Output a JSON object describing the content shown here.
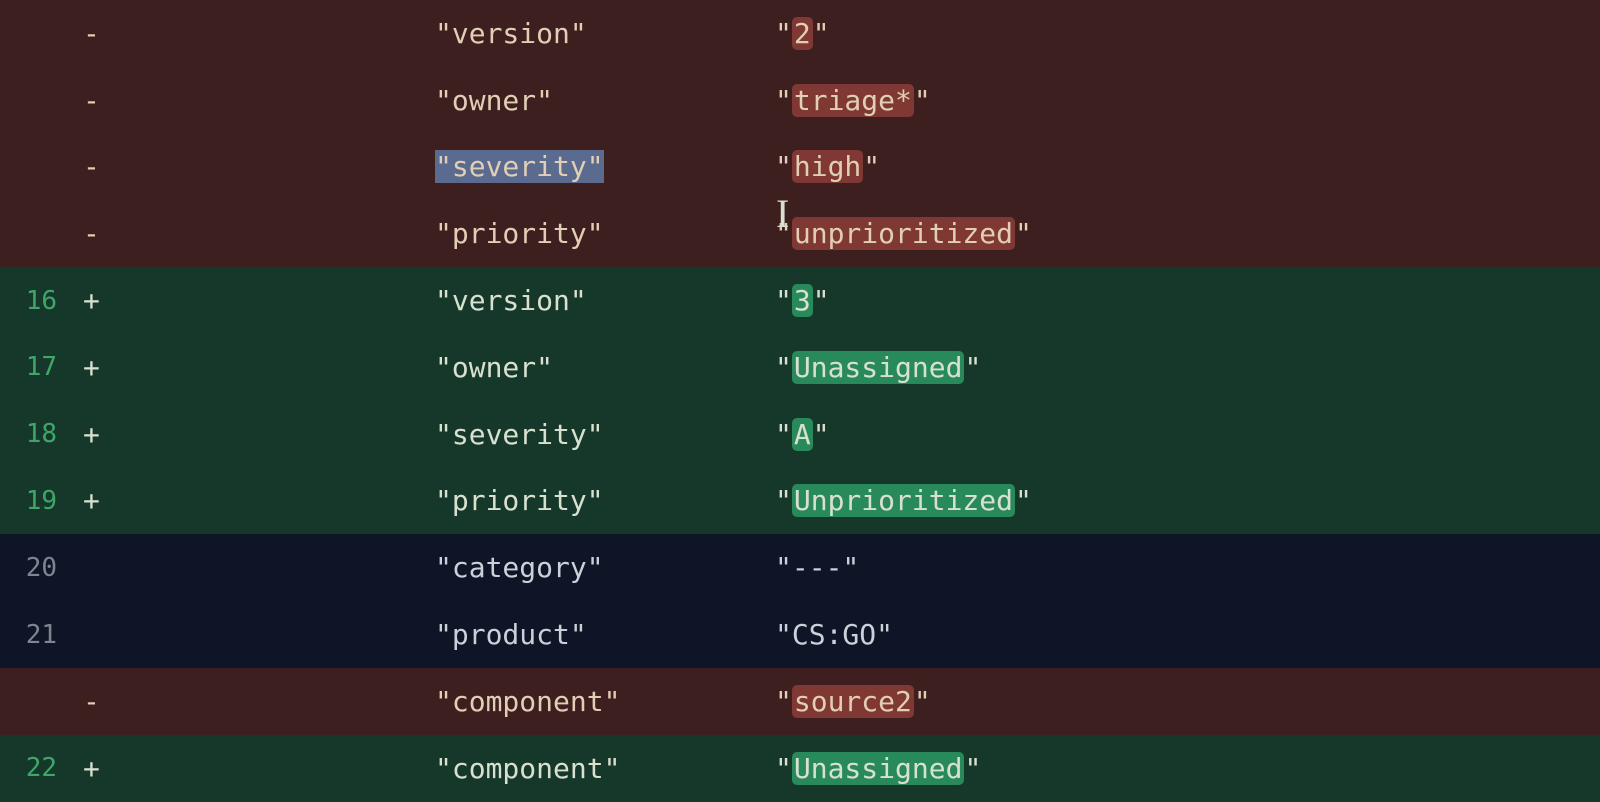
{
  "lines": [
    {
      "type": "removed",
      "lineno": "",
      "sign": "-",
      "key": "\"version\"",
      "key_hl": "",
      "val_pre": "\"",
      "val_hl": "2",
      "val_post": "\"",
      "hl_class": "hl-del"
    },
    {
      "type": "removed",
      "lineno": "",
      "sign": "-",
      "key": "\"owner\"",
      "key_hl": "",
      "val_pre": "\"",
      "val_hl": "triage*",
      "val_post": "\"",
      "hl_class": "hl-del"
    },
    {
      "type": "removed",
      "lineno": "",
      "sign": "-",
      "key": "\"severity\"",
      "key_hl": "sel",
      "val_pre": "\"",
      "val_hl": "high",
      "val_post": "\"",
      "hl_class": "hl-del"
    },
    {
      "type": "removed",
      "lineno": "",
      "sign": "-",
      "key": "\"priority\"",
      "key_hl": "",
      "val_pre": "\"",
      "val_hl": "unprioritized",
      "val_post": "\"",
      "hl_class": "hl-del"
    },
    {
      "type": "added",
      "lineno": "16",
      "sign": "+",
      "key": "\"version\"",
      "key_hl": "",
      "val_pre": "\"",
      "val_hl": "3",
      "val_post": "\"",
      "hl_class": "hl-add"
    },
    {
      "type": "added",
      "lineno": "17",
      "sign": "+",
      "key": "\"owner\"",
      "key_hl": "",
      "val_pre": "\"",
      "val_hl": "Unassigned",
      "val_post": "\"",
      "hl_class": "hl-add"
    },
    {
      "type": "added",
      "lineno": "18",
      "sign": "+",
      "key": "\"severity\"",
      "key_hl": "",
      "val_pre": "\"",
      "val_hl": "A",
      "val_post": "\"",
      "hl_class": "hl-add"
    },
    {
      "type": "added",
      "lineno": "19",
      "sign": "+",
      "key": "\"priority\"",
      "key_hl": "",
      "val_pre": "\"",
      "val_hl": "Unprioritized",
      "val_post": "\"",
      "hl_class": "hl-add"
    },
    {
      "type": "context",
      "lineno": "20",
      "sign": "",
      "key": "\"category\"",
      "key_hl": "",
      "val_pre": "\"---\"",
      "val_hl": "",
      "val_post": "",
      "hl_class": ""
    },
    {
      "type": "context",
      "lineno": "21",
      "sign": "",
      "key": "\"product\"",
      "key_hl": "",
      "val_pre": "\"CS:GO\"",
      "val_hl": "",
      "val_post": "",
      "hl_class": ""
    },
    {
      "type": "removed",
      "lineno": "",
      "sign": "-",
      "key": "\"component\"",
      "key_hl": "",
      "val_pre": "\"",
      "val_hl": "source2",
      "val_post": "\"",
      "hl_class": "hl-del"
    },
    {
      "type": "added",
      "lineno": "22",
      "sign": "+",
      "key": "\"component\"",
      "key_hl": "",
      "val_pre": "\"",
      "val_hl": "Unassigned",
      "val_post": "\"",
      "hl_class": "hl-add"
    }
  ]
}
